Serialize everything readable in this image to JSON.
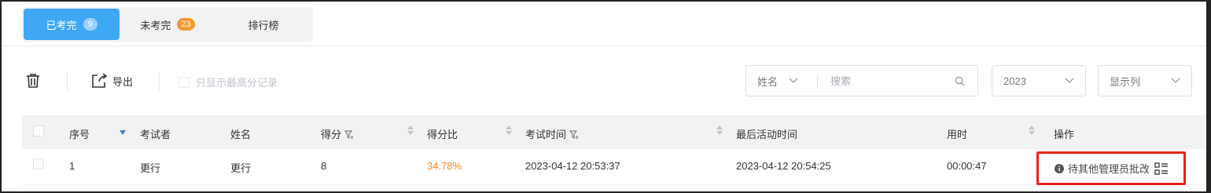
{
  "tabs": [
    {
      "label": "已考完",
      "count": "9",
      "active": true
    },
    {
      "label": "未考完",
      "count": "23",
      "active": false
    },
    {
      "label": "排行榜",
      "count": null,
      "active": false
    }
  ],
  "toolbar": {
    "export_label": "导出",
    "only_max_label": "只显示最高分记录",
    "search_field": "姓名",
    "search_placeholder": "搜索",
    "year": "2023",
    "columns_label": "显示列"
  },
  "table": {
    "headers": {
      "index": "序号",
      "examinee": "考试者",
      "name": "姓名",
      "score": "得分",
      "ratio": "得分比",
      "exam_time": "考试时间",
      "last_active": "最后活动时间",
      "duration": "用时",
      "actions": "操作"
    },
    "rows": [
      {
        "index": "1",
        "examinee": "更行",
        "name": "更行",
        "score": "8",
        "ratio": "34.78%",
        "exam_time": "2023-04-12 20:53:37",
        "last_active": "2023-04-12 20:54:25",
        "duration": "00:00:47",
        "action": "待其他管理员批改"
      }
    ]
  },
  "colors": {
    "accent": "#3ea8f5",
    "badge_orange": "#f59a2e",
    "ratio_orange": "#f08a24",
    "highlight_red": "#e8231a"
  },
  "icons": [
    "trash-icon",
    "export-icon",
    "chevron-down-icon",
    "search-icon",
    "filter-icon",
    "info-icon",
    "list-icon"
  ]
}
